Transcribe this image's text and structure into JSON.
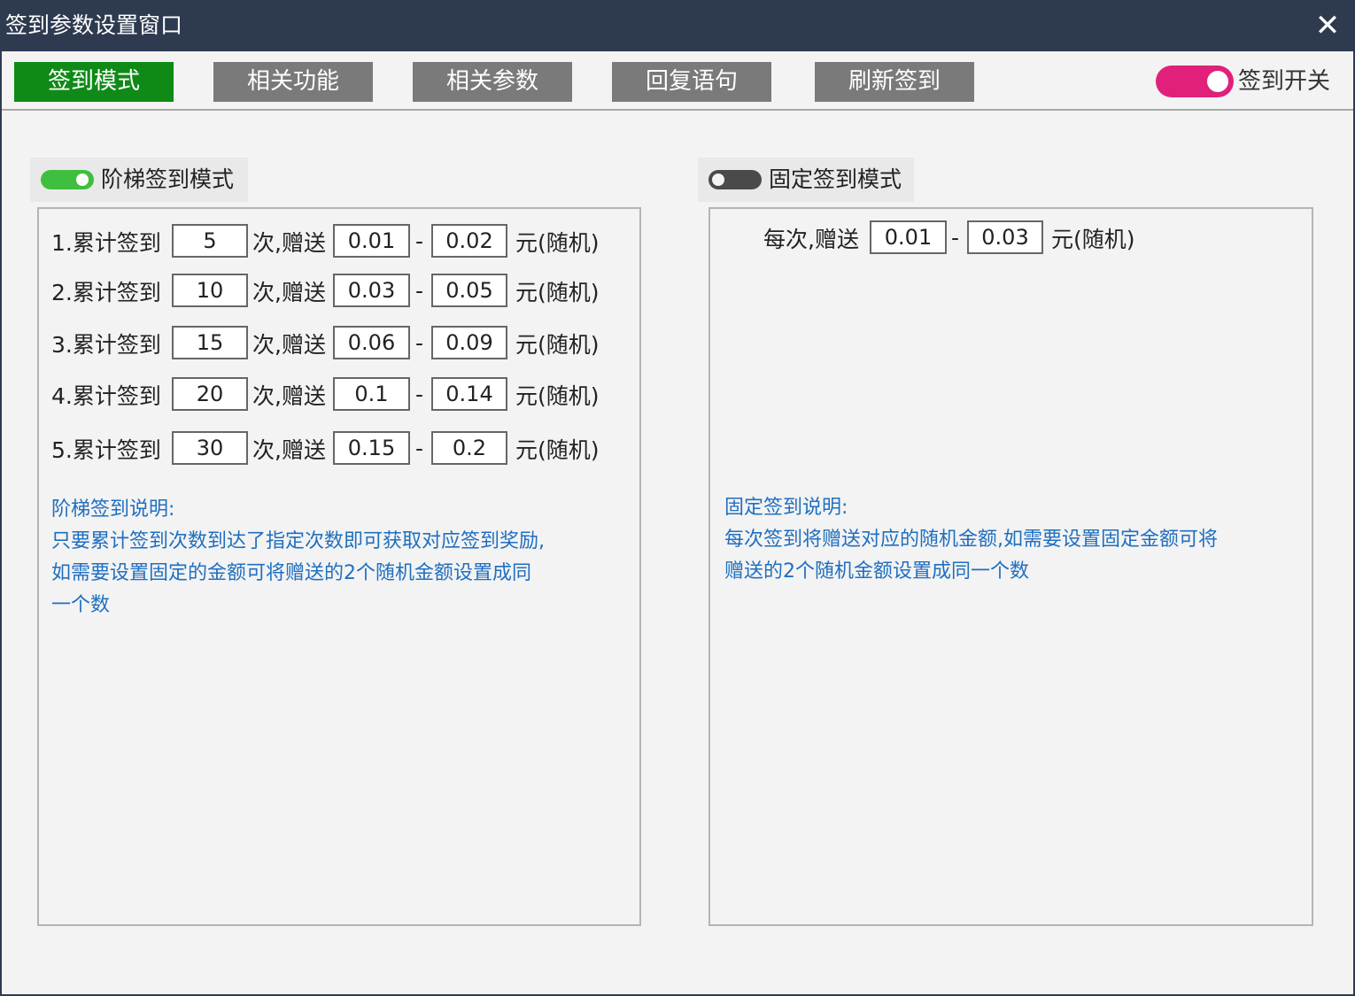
{
  "window": {
    "title": "签到参数设置窗口",
    "close_label": "✕"
  },
  "tabs": [
    {
      "label": "签到模式",
      "active": true
    },
    {
      "label": "相关功能",
      "active": false
    },
    {
      "label": "相关参数",
      "active": false
    },
    {
      "label": "回复语句",
      "active": false
    },
    {
      "label": "刷新签到",
      "active": false
    }
  ],
  "master_switch": {
    "label": "签到开关",
    "on": true,
    "color": "#e0207a"
  },
  "ladder": {
    "title": "阶梯签到模式",
    "enabled": true,
    "times_suffix": "次,赠送",
    "dash": "-",
    "unit": "元(随机)",
    "rows": [
      {
        "prefix": "1.累计签到",
        "count": "5",
        "min": "0.01",
        "max": "0.02"
      },
      {
        "prefix": "2.累计签到",
        "count": "10",
        "min": "0.03",
        "max": "0.05"
      },
      {
        "prefix": "3.累计签到",
        "count": "15",
        "min": "0.06",
        "max": "0.09"
      },
      {
        "prefix": "4.累计签到",
        "count": "20",
        "min": "0.1",
        "max": "0.14"
      },
      {
        "prefix": "5.累计签到",
        "count": "30",
        "min": "0.15",
        "max": "0.2"
      }
    ],
    "note_lines": [
      "阶梯签到说明:",
      "只要累计签到次数到达了指定次数即可获取对应签到奖励,",
      "如需要设置固定的金额可将赠送的2个随机金额设置成同",
      "一个数"
    ]
  },
  "fixed": {
    "title": "固定签到模式",
    "enabled": false,
    "prefix": "每次,赠送",
    "min": "0.01",
    "dash": "-",
    "max": "0.03",
    "unit": "元(随机)",
    "note_lines": [
      "固定签到说明:",
      "每次签到将赠送对应的随机金额,如需要设置固定金额可将",
      "赠送的2个随机金额设置成同一个数"
    ]
  },
  "colors": {
    "titlebar": "#2e3a50",
    "active_tab": "#0f8a17",
    "inactive_tab": "#7a7a7a",
    "switch_on": "#3fbf3f",
    "note_text": "#1f6fc0"
  }
}
